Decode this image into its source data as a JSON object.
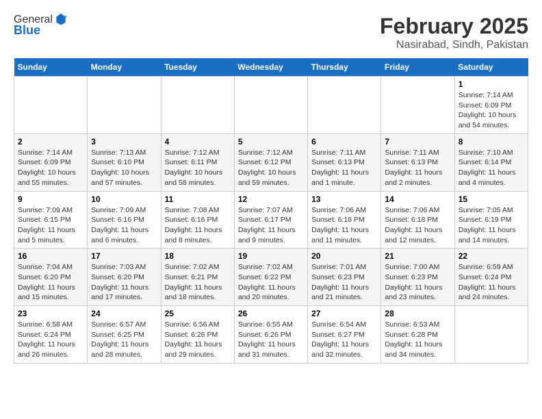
{
  "header": {
    "logo_line1": "General",
    "logo_line2": "Blue",
    "title": "February 2025",
    "subtitle": "Nasirabad, Sindh, Pakistan"
  },
  "calendar": {
    "days_of_week": [
      "Sunday",
      "Monday",
      "Tuesday",
      "Wednesday",
      "Thursday",
      "Friday",
      "Saturday"
    ],
    "weeks": [
      [
        {
          "day": "",
          "info": ""
        },
        {
          "day": "",
          "info": ""
        },
        {
          "day": "",
          "info": ""
        },
        {
          "day": "",
          "info": ""
        },
        {
          "day": "",
          "info": ""
        },
        {
          "day": "",
          "info": ""
        },
        {
          "day": "1",
          "info": "Sunrise: 7:14 AM\nSunset: 6:09 PM\nDaylight: 10 hours\nand 54 minutes."
        }
      ],
      [
        {
          "day": "2",
          "info": "Sunrise: 7:14 AM\nSunset: 6:09 PM\nDaylight: 10 hours\nand 55 minutes."
        },
        {
          "day": "3",
          "info": "Sunrise: 7:13 AM\nSunset: 6:10 PM\nDaylight: 10 hours\nand 57 minutes."
        },
        {
          "day": "4",
          "info": "Sunrise: 7:12 AM\nSunset: 6:11 PM\nDaylight: 10 hours\nand 58 minutes."
        },
        {
          "day": "5",
          "info": "Sunrise: 7:12 AM\nSunset: 6:12 PM\nDaylight: 10 hours\nand 59 minutes."
        },
        {
          "day": "6",
          "info": "Sunrise: 7:11 AM\nSunset: 6:13 PM\nDaylight: 11 hours\nand 1 minute."
        },
        {
          "day": "7",
          "info": "Sunrise: 7:11 AM\nSunset: 6:13 PM\nDaylight: 11 hours\nand 2 minutes."
        },
        {
          "day": "8",
          "info": "Sunrise: 7:10 AM\nSunset: 6:14 PM\nDaylight: 11 hours\nand 4 minutes."
        }
      ],
      [
        {
          "day": "9",
          "info": "Sunrise: 7:09 AM\nSunset: 6:15 PM\nDaylight: 11 hours\nand 5 minutes."
        },
        {
          "day": "10",
          "info": "Sunrise: 7:09 AM\nSunset: 6:16 PM\nDaylight: 11 hours\nand 6 minutes."
        },
        {
          "day": "11",
          "info": "Sunrise: 7:08 AM\nSunset: 6:16 PM\nDaylight: 11 hours\nand 8 minutes."
        },
        {
          "day": "12",
          "info": "Sunrise: 7:07 AM\nSunset: 6:17 PM\nDaylight: 11 hours\nand 9 minutes."
        },
        {
          "day": "13",
          "info": "Sunrise: 7:06 AM\nSunset: 6:18 PM\nDaylight: 11 hours\nand 11 minutes."
        },
        {
          "day": "14",
          "info": "Sunrise: 7:06 AM\nSunset: 6:18 PM\nDaylight: 11 hours\nand 12 minutes."
        },
        {
          "day": "15",
          "info": "Sunrise: 7:05 AM\nSunset: 6:19 PM\nDaylight: 11 hours\nand 14 minutes."
        }
      ],
      [
        {
          "day": "16",
          "info": "Sunrise: 7:04 AM\nSunset: 6:20 PM\nDaylight: 11 hours\nand 15 minutes."
        },
        {
          "day": "17",
          "info": "Sunrise: 7:03 AM\nSunset: 6:20 PM\nDaylight: 11 hours\nand 17 minutes."
        },
        {
          "day": "18",
          "info": "Sunrise: 7:02 AM\nSunset: 6:21 PM\nDaylight: 11 hours\nand 18 minutes."
        },
        {
          "day": "19",
          "info": "Sunrise: 7:02 AM\nSunset: 6:22 PM\nDaylight: 11 hours\nand 20 minutes."
        },
        {
          "day": "20",
          "info": "Sunrise: 7:01 AM\nSunset: 6:23 PM\nDaylight: 11 hours\nand 21 minutes."
        },
        {
          "day": "21",
          "info": "Sunrise: 7:00 AM\nSunset: 6:23 PM\nDaylight: 11 hours\nand 23 minutes."
        },
        {
          "day": "22",
          "info": "Sunrise: 6:59 AM\nSunset: 6:24 PM\nDaylight: 11 hours\nand 24 minutes."
        }
      ],
      [
        {
          "day": "23",
          "info": "Sunrise: 6:58 AM\nSunset: 6:24 PM\nDaylight: 11 hours\nand 26 minutes."
        },
        {
          "day": "24",
          "info": "Sunrise: 6:57 AM\nSunset: 6:25 PM\nDaylight: 11 hours\nand 28 minutes."
        },
        {
          "day": "25",
          "info": "Sunrise: 6:56 AM\nSunset: 6:26 PM\nDaylight: 11 hours\nand 29 minutes."
        },
        {
          "day": "26",
          "info": "Sunrise: 6:55 AM\nSunset: 6:26 PM\nDaylight: 11 hours\nand 31 minutes."
        },
        {
          "day": "27",
          "info": "Sunrise: 6:54 AM\nSunset: 6:27 PM\nDaylight: 11 hours\nand 32 minutes."
        },
        {
          "day": "28",
          "info": "Sunrise: 6:53 AM\nSunset: 6:28 PM\nDaylight: 11 hours\nand 34 minutes."
        },
        {
          "day": "",
          "info": ""
        }
      ]
    ]
  }
}
